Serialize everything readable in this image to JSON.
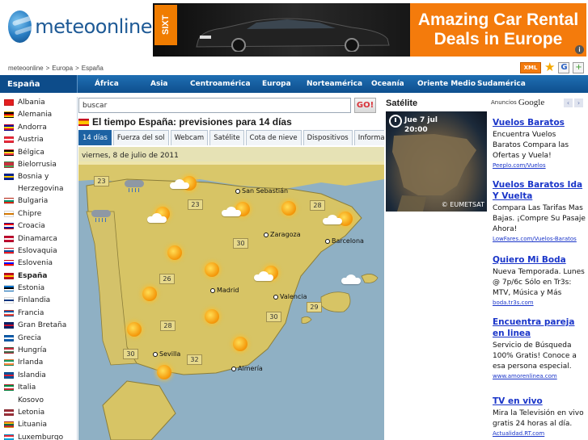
{
  "logo": {
    "text": "meteoonline"
  },
  "banner": {
    "brand": "SIXT",
    "headline_line1": "Amazing Car Rental",
    "headline_line2": "Deals in Europe",
    "badge": "i"
  },
  "breadcrumb": [
    "meteoonline",
    "Europa",
    "España"
  ],
  "breadcrumb_sep": ">",
  "toolbar": {
    "xml_label": "XML",
    "g_label": "G",
    "add_label": "+"
  },
  "nav": {
    "current": "España",
    "regions": [
      "África",
      "Asia",
      "Centroamérica",
      "Europa",
      "Norteamérica",
      "Oceanía",
      "Oriente Medio",
      "Sudamérica"
    ]
  },
  "sidebar": {
    "countries": [
      {
        "name": "Albania",
        "flag": [
          "#e41e20",
          "#e41e20"
        ]
      },
      {
        "name": "Alemania",
        "flag": [
          "#000000",
          "#dd0000",
          "#ffce00"
        ]
      },
      {
        "name": "Andorra",
        "flag": [
          "#10069f",
          "#fedd00",
          "#d50032"
        ]
      },
      {
        "name": "Austria",
        "flag": [
          "#ed2939",
          "#ffffff",
          "#ed2939"
        ]
      },
      {
        "name": "Bélgica",
        "flag": [
          "#000000",
          "#fdda24",
          "#ef3340"
        ]
      },
      {
        "name": "Bielorrusia",
        "flag": [
          "#c8313e",
          "#c8313e",
          "#4aa657"
        ]
      },
      {
        "name": "Bosnia y Herzegovina",
        "flag": [
          "#002395",
          "#fecb00",
          "#002395"
        ]
      },
      {
        "name": "Bulgaria",
        "flag": [
          "#ffffff",
          "#00966e",
          "#d62612"
        ]
      },
      {
        "name": "Chipre",
        "flag": [
          "#ffffff",
          "#d57800",
          "#ffffff"
        ]
      },
      {
        "name": "Croacia",
        "flag": [
          "#ff0000",
          "#ffffff",
          "#171796"
        ]
      },
      {
        "name": "Dinamarca",
        "flag": [
          "#c60c30",
          "#ffffff",
          "#c60c30"
        ]
      },
      {
        "name": "Eslovaquia",
        "flag": [
          "#ffffff",
          "#0b4ea2",
          "#ee1c25"
        ]
      },
      {
        "name": "Eslovenia",
        "flag": [
          "#ffffff",
          "#0000ff",
          "#ff0000"
        ]
      },
      {
        "name": "España",
        "flag": [
          "#c60b1e",
          "#ffc400",
          "#c60b1e"
        ],
        "selected": true
      },
      {
        "name": "Estonia",
        "flag": [
          "#0072ce",
          "#000000",
          "#ffffff"
        ]
      },
      {
        "name": "Finlandia",
        "flag": [
          "#ffffff",
          "#003580",
          "#ffffff"
        ]
      },
      {
        "name": "Francia",
        "flag": [
          "#0055a4",
          "#ffffff",
          "#ef4135"
        ]
      },
      {
        "name": "Gran Bretaña",
        "flag": [
          "#012169",
          "#c8102e",
          "#012169"
        ]
      },
      {
        "name": "Grecia",
        "flag": [
          "#0d5eaf",
          "#ffffff",
          "#0d5eaf"
        ]
      },
      {
        "name": "Hungría",
        "flag": [
          "#cd2a3e",
          "#ffffff",
          "#436f4d"
        ]
      },
      {
        "name": "Irlanda",
        "flag": [
          "#169b62",
          "#ffffff",
          "#ff883e"
        ]
      },
      {
        "name": "Islandia",
        "flag": [
          "#02529c",
          "#dc1e35",
          "#02529c"
        ]
      },
      {
        "name": "Italia",
        "flag": [
          "#009246",
          "#ffffff",
          "#ce2b37"
        ]
      },
      {
        "name": "Kosovo",
        "flag": null
      },
      {
        "name": "Letonia",
        "flag": [
          "#9e3039",
          "#ffffff",
          "#9e3039"
        ]
      },
      {
        "name": "Lituania",
        "flag": [
          "#fdb913",
          "#006a44",
          "#c1272d"
        ]
      },
      {
        "name": "Luxemburgo",
        "flag": [
          "#ed2939",
          "#ffffff",
          "#00a1de"
        ]
      }
    ]
  },
  "search": {
    "value": "buscar",
    "button": "GO!"
  },
  "section": {
    "title": "El tiempo España: previsiones para 14 días"
  },
  "tabs": [
    "14 días",
    "Fuerza del sol",
    "Webcam",
    "Satélite",
    "Cota de nieve",
    "Dispositivos",
    "Información de"
  ],
  "map": {
    "date": "viernes,  8 de julio de 2011",
    "cities": [
      "San Sebastián",
      "Zaragoza",
      "Barcelona",
      "Madrid",
      "Valencia",
      "Sevilla",
      "Almería"
    ],
    "temps": [
      "23",
      "23",
      "28",
      "30",
      "26",
      "30",
      "29",
      "28",
      "30",
      "32"
    ]
  },
  "satellite": {
    "title": "Satélite",
    "date": "Jue  7 jul",
    "time": "20:00",
    "credit": "© EUMETSAT"
  },
  "ads": {
    "label": "Anuncios",
    "provider": "Google",
    "prev": "‹",
    "next": "›",
    "items": [
      {
        "title": "Vuelos Baratos",
        "body": "Encuentra Vuelos Baratos Compara las Ofertas y Vuela!",
        "url": "Peeplo.com/Vuelos"
      },
      {
        "title": "Vuelos Baratos Ida Y Vuelta",
        "body": "Compara Las Tarifas Mas Bajas. ¡Compre Su Pasaje Ahora!",
        "url": "LowFares.com/Vuelos-Baratos"
      },
      {
        "title": "Quiero Mi Boda",
        "body": "Nueva Temporada. Lunes @ 7p/6c Sólo en Tr3s: MTV, Música y Más",
        "url": "boda.tr3s.com"
      },
      {
        "title": "Encuentra pareja en linea",
        "body": "Servicio de Búsqueda 100% Gratis! Conoce a esa persona especial.",
        "url": "www.amorenlinea.com"
      },
      {
        "title": "TV en vivo",
        "body": "Mira la Televisión en vivo gratis 24 horas al día.",
        "url": "Actualidad.RT.com"
      }
    ]
  },
  "colors": {
    "nav": "#1f6fb3",
    "accent": "#f47b0c",
    "land": "#d9c76a",
    "sea": "#8fb0c4",
    "link": "#1a35c9"
  }
}
